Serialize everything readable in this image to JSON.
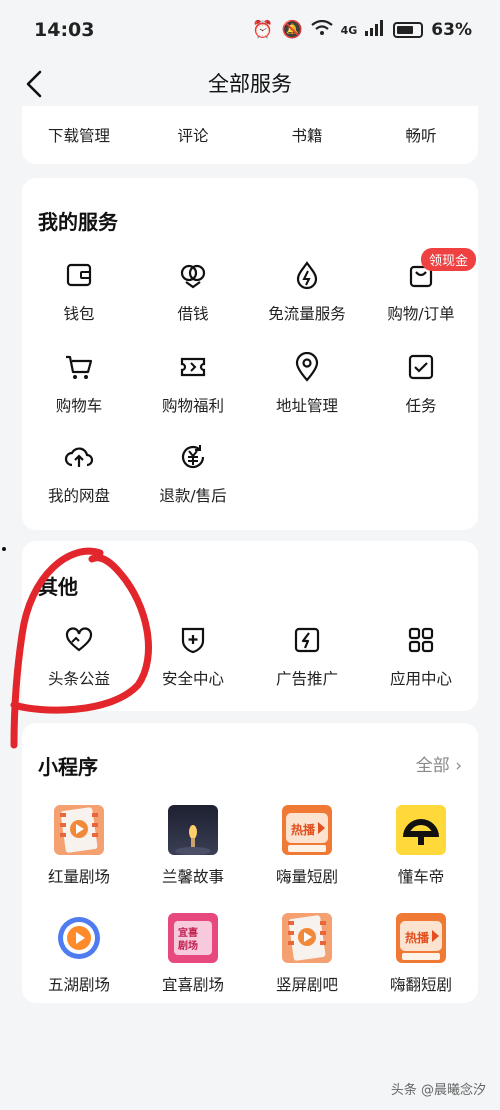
{
  "status": {
    "time": "14:03",
    "battery": "63%",
    "network": "4G"
  },
  "nav": {
    "title": "全部服务"
  },
  "top_row": [
    {
      "label": "下载管理"
    },
    {
      "label": "评论"
    },
    {
      "label": "书籍"
    },
    {
      "label": "畅听"
    }
  ],
  "services": {
    "title": "我的服务",
    "badge": "领现金",
    "items": [
      {
        "label": "钱包",
        "icon": "wallet-icon"
      },
      {
        "label": "借钱",
        "icon": "loan-icon"
      },
      {
        "label": "免流量服务",
        "icon": "data-free-icon"
      },
      {
        "label": "购物/订单",
        "icon": "order-bag-icon"
      },
      {
        "label": "购物车",
        "icon": "cart-icon"
      },
      {
        "label": "购物福利",
        "icon": "coupon-icon"
      },
      {
        "label": "地址管理",
        "icon": "location-icon"
      },
      {
        "label": "任务",
        "icon": "task-check-icon"
      },
      {
        "label": "我的网盘",
        "icon": "cloud-upload-icon"
      },
      {
        "label": "退款/售后",
        "icon": "refund-icon"
      }
    ]
  },
  "other": {
    "title": "其他",
    "items": [
      {
        "label": "头条公益",
        "icon": "heart-charity-icon"
      },
      {
        "label": "安全中心",
        "icon": "shield-plus-icon"
      },
      {
        "label": "广告推广",
        "icon": "lightning-icon"
      },
      {
        "label": "应用中心",
        "icon": "apps-grid-icon"
      }
    ]
  },
  "mini": {
    "title": "小程序",
    "more": "全部 ›",
    "items": [
      {
        "label": "红量剧场",
        "icon": "film-orange-icon"
      },
      {
        "label": "兰馨故事",
        "icon": "candle-dark-icon"
      },
      {
        "label": "嗨量短剧",
        "icon": "hot-drama-icon"
      },
      {
        "label": "懂车帝",
        "icon": "dongchedi-icon"
      },
      {
        "label": "五湖剧场",
        "icon": "play-circle-icon"
      },
      {
        "label": "宜喜剧场",
        "icon": "yixi-theater-icon"
      },
      {
        "label": "竖屏剧吧",
        "icon": "film-orange-icon"
      },
      {
        "label": "嗨翻短剧",
        "icon": "hot-drama-icon"
      }
    ],
    "tag_hot": "热播"
  },
  "watermark": "头条 @晨曦念汐"
}
